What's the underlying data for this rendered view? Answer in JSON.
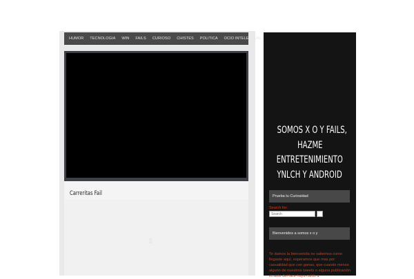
{
  "nav": {
    "items": [
      "HUMOR",
      "TECNOLOGIA",
      "WIN",
      "FAILS",
      "CURIOSO",
      "CHISTES",
      "POLITICA",
      "OCIO INTELECTUAL"
    ]
  },
  "post": {
    "title": "Carreritas Fail"
  },
  "sidebar": {
    "tagline_lines": [
      "SOMOS X O Y FAILS,",
      "HAZME",
      "ENTRETENIMIENTO",
      "YNLCH Y ANDROID"
    ],
    "widget1_title": "Prueba tu Curiosidad",
    "search_label": "Search for:",
    "search_placeholder": "Search",
    "widget2_title": "Bienvenidos a somos x o y",
    "welcome_text": "Te damos la bienvenida no sabemos como llegaste aquí, esperamos que mas por casualidad que con ganas, que cuando menos alguno de nuestros tweets o alguna publicación errante del face haya caído a"
  },
  "colors": {
    "nav_bg": "#4a4a4a",
    "sidebar_bg": "#141414",
    "accent_red": "#d13a1a"
  }
}
